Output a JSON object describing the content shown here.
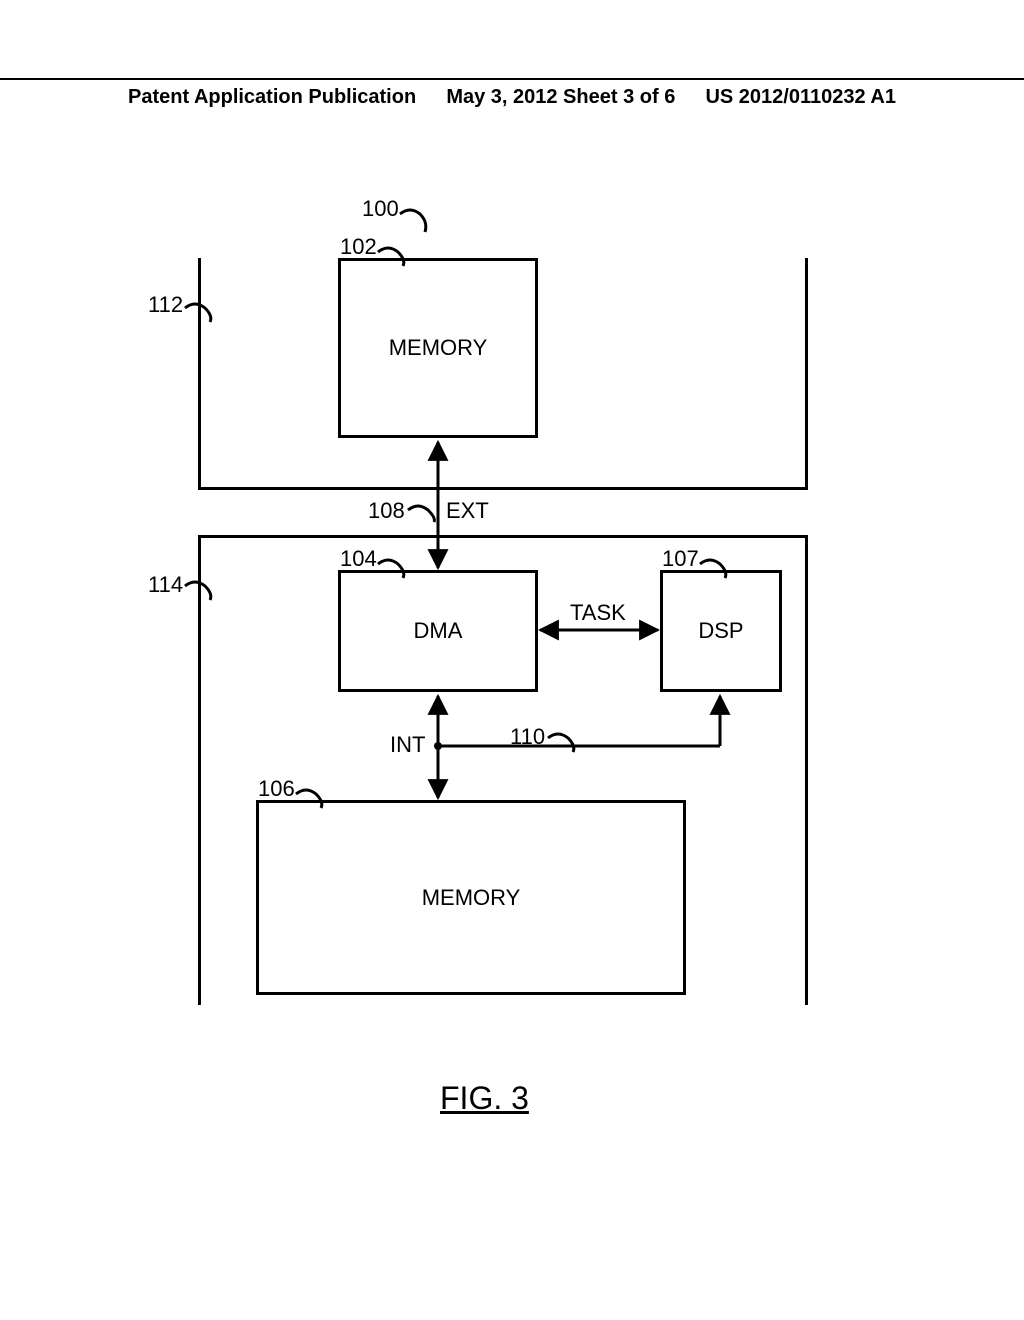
{
  "header": {
    "left": "Patent Application Publication",
    "center": "May 3, 2012  Sheet 3 of 6",
    "right": "US 2012/0110232 A1"
  },
  "refs": {
    "r100": "100",
    "r102": "102",
    "r104": "104",
    "r106": "106",
    "r107": "107",
    "r108": "108",
    "r110": "110",
    "r112": "112",
    "r114": "114"
  },
  "blocks": {
    "memory_top": "MEMORY",
    "dma": "DMA",
    "dsp": "DSP",
    "memory_bot": "MEMORY"
  },
  "edges": {
    "ext": "EXT",
    "int": "INT",
    "task": "TASK"
  },
  "figure": "FIG. 3"
}
